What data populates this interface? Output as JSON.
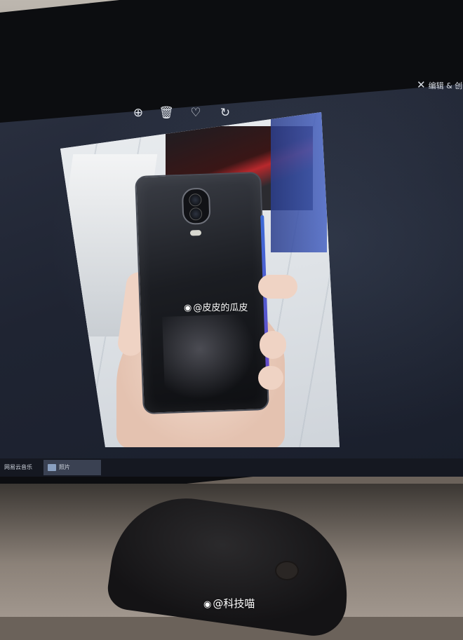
{
  "toolbar": {
    "zoom_icon": "zoom-in-icon",
    "delete_icon": "trash-icon",
    "favorite_icon": "heart-icon",
    "rotate_icon": "rotate-icon",
    "edit_label": "编辑 & 创"
  },
  "photo": {
    "watermark": "@皮皮的瓜皮"
  },
  "taskbar": {
    "items": [
      {
        "label": "网易云音乐"
      },
      {
        "label": "照片"
      }
    ]
  },
  "footer": {
    "watermark": "@科技喵"
  }
}
